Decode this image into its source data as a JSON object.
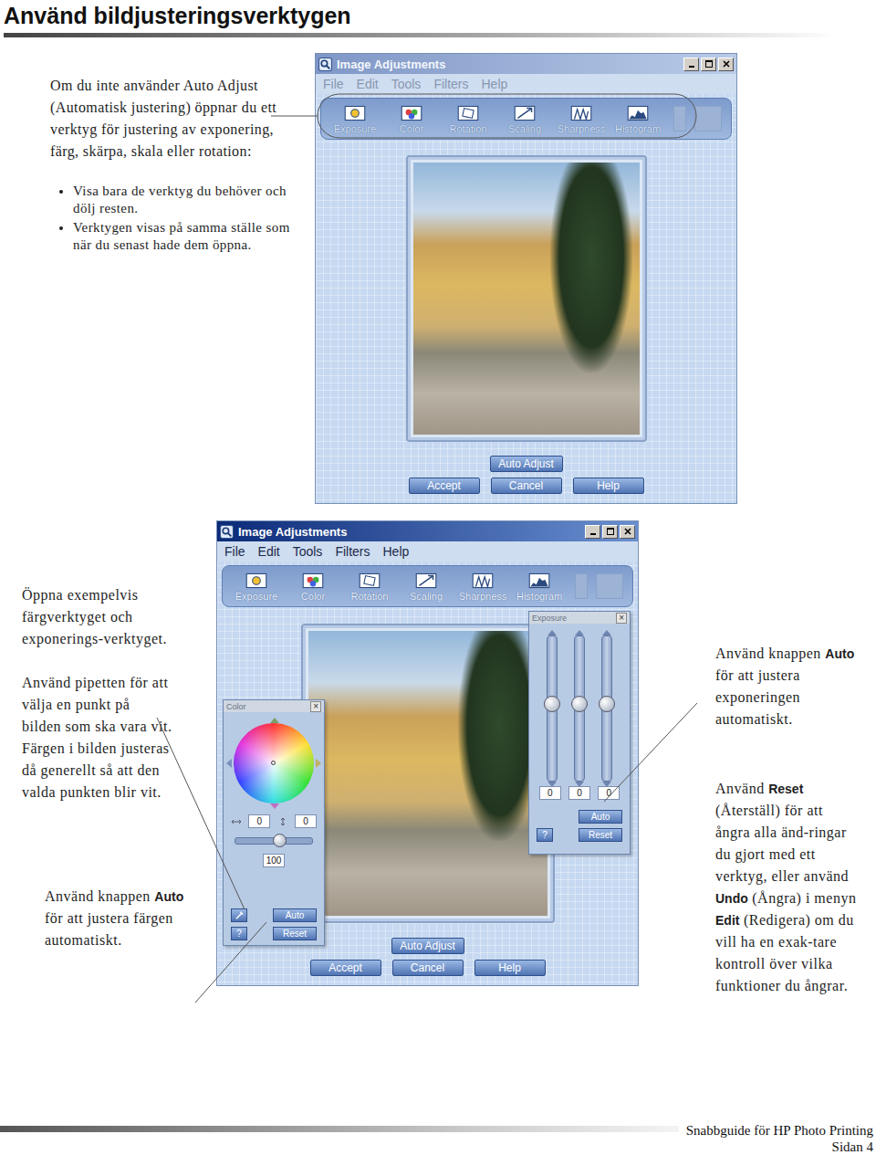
{
  "page_title": "Använd bildjusteringsverktygen",
  "intro": {
    "paragraph": [
      {
        "text": "Om du inte använder Auto Adjust (Automatisk justering) öppnar du ett verktyg för justering av exponering, färg, skärpa, skala eller rotation:",
        "kind": "plain"
      }
    ],
    "bullets": [
      "Visa bara de verktyg du behöver och dölj resten.",
      "Verktygen visas på samma ställe som när du senast hade dem öppna."
    ]
  },
  "windows": [
    {
      "title": "Image Adjustments",
      "active": false,
      "menu": [
        "File",
        "Edit",
        "Tools",
        "Filters",
        "Help"
      ],
      "tools": [
        "Exposure",
        "Color",
        "Rotation",
        "Scaling",
        "Sharpness",
        "Histogram"
      ],
      "auto_adjust": "Auto Adjust",
      "buttons": [
        "Accept",
        "Cancel",
        "Help"
      ],
      "panels": []
    },
    {
      "title": "Image Adjustments",
      "active": true,
      "menu": [
        "File",
        "Edit",
        "Tools",
        "Filters",
        "Help"
      ],
      "tools": [
        "Exposure",
        "Color",
        "Rotation",
        "Scaling",
        "Sharpness",
        "Histogram"
      ],
      "auto_adjust": "Auto Adjust",
      "buttons": [
        "Accept",
        "Cancel",
        "Help"
      ],
      "panels": [
        {
          "kind": "color",
          "title": "Color",
          "close": "×",
          "values": [
            "0",
            "0"
          ],
          "level": 0.57,
          "amount": "100",
          "auto": "Auto",
          "help": "?",
          "reset": "Reset"
        },
        {
          "kind": "exposure",
          "title": "Exposure",
          "close": "×",
          "sliders": [
            {
              "level": 0.53,
              "value": "0"
            },
            {
              "level": 0.53,
              "value": "0"
            },
            {
              "level": 0.53,
              "value": "0"
            }
          ],
          "auto": "Auto",
          "help": "?",
          "reset": "Reset"
        }
      ]
    }
  ],
  "notes_left": [
    [
      {
        "text": "Öppna exempelvis färgverktyget och exponerings-verktyget.",
        "kind": "plain"
      }
    ],
    [
      {
        "text": "Använd pipetten för att välja en punkt på bilden som ska vara vit. Färgen i bilden justeras då generellt så att den valda punkten blir vit.",
        "kind": "plain"
      }
    ],
    [
      {
        "text": "Använd knappen ",
        "kind": "plain"
      },
      {
        "text": "Auto",
        "kind": "ui"
      },
      {
        "text": " för att justera färgen automatiskt.",
        "kind": "plain"
      }
    ]
  ],
  "notes_right": [
    [
      {
        "text": "Använd knappen ",
        "kind": "plain"
      },
      {
        "text": "Auto",
        "kind": "ui"
      },
      {
        "text": " för att justera exponeringen automatiskt.",
        "kind": "plain"
      }
    ],
    [
      {
        "text": "Använd ",
        "kind": "plain"
      },
      {
        "text": "Reset",
        "kind": "ui"
      },
      {
        "text": " (Återställ) för att ångra alla änd-ringar du gjort med ett verktyg, eller använd ",
        "kind": "plain"
      },
      {
        "text": "Undo",
        "kind": "ui"
      },
      {
        "text": " (Ångra) i menyn ",
        "kind": "plain"
      },
      {
        "text": "Edit",
        "kind": "ui"
      },
      {
        "text": " (Redigera) om du vill ha en exak-tare kontroll över vilka funktioner du ångrar.",
        "kind": "plain"
      }
    ]
  ],
  "footer": {
    "guide": "Snabbguide för HP Photo Printing",
    "page": "Sidan 4"
  }
}
